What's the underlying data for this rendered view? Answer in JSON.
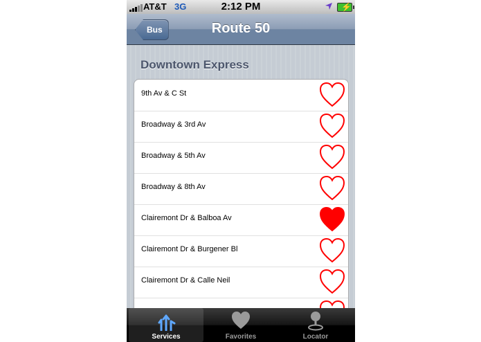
{
  "status_bar": {
    "carrier": "AT&T",
    "network": "3G",
    "time": "2:12 PM"
  },
  "nav": {
    "back_label": "Bus",
    "title": "Route 50"
  },
  "section": {
    "title": "Downtown Express"
  },
  "stops": [
    {
      "name": "9th Av & C St",
      "favorite": false
    },
    {
      "name": "Broadway & 3rd Av",
      "favorite": false
    },
    {
      "name": "Broadway & 5th Av",
      "favorite": false
    },
    {
      "name": "Broadway & 8th Av",
      "favorite": false
    },
    {
      "name": "Clairemont Dr & Balboa Av",
      "favorite": true
    },
    {
      "name": "Clairemont Dr & Burgener Bl",
      "favorite": false
    },
    {
      "name": "Clairemont Dr & Calle Neil",
      "favorite": false
    },
    {
      "name": "",
      "favorite": false
    }
  ],
  "tabs": [
    {
      "label": "Services",
      "icon": "services-icon",
      "selected": true
    },
    {
      "label": "Favorites",
      "icon": "favorites-heart-icon",
      "selected": false
    },
    {
      "label": "Locator",
      "icon": "locator-icon",
      "selected": false
    }
  ],
  "colors": {
    "heart": "#ff0000",
    "nav": "#6d84a2",
    "tab_selected": "#ffffff"
  }
}
